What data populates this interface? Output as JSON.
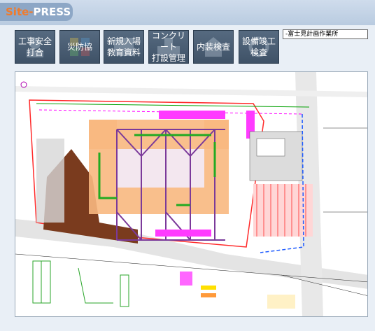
{
  "app": {
    "logo_main": "Site-",
    "logo_accent": "PRESS"
  },
  "menu": [
    {
      "label": "工事安全\n打合",
      "icon": "safety-meeting-icon"
    },
    {
      "label": "災防協",
      "icon": "disaster-prevention-icon"
    },
    {
      "label": "新規入場\n教育資料",
      "icon": "new-entry-education-icon"
    },
    {
      "label": "コンクリート\n打設管理",
      "icon": "concrete-pour-icon"
    },
    {
      "label": "内装検査",
      "icon": "interior-inspection-icon"
    },
    {
      "label": "設備竣工\n検査",
      "icon": "equipment-inspection-icon"
    }
  ],
  "site": {
    "name": "-富士見計画作業所"
  },
  "colors": {
    "header": "#b9cbe0",
    "button": "#4a5d72",
    "logo_text": "#f07b2c"
  }
}
